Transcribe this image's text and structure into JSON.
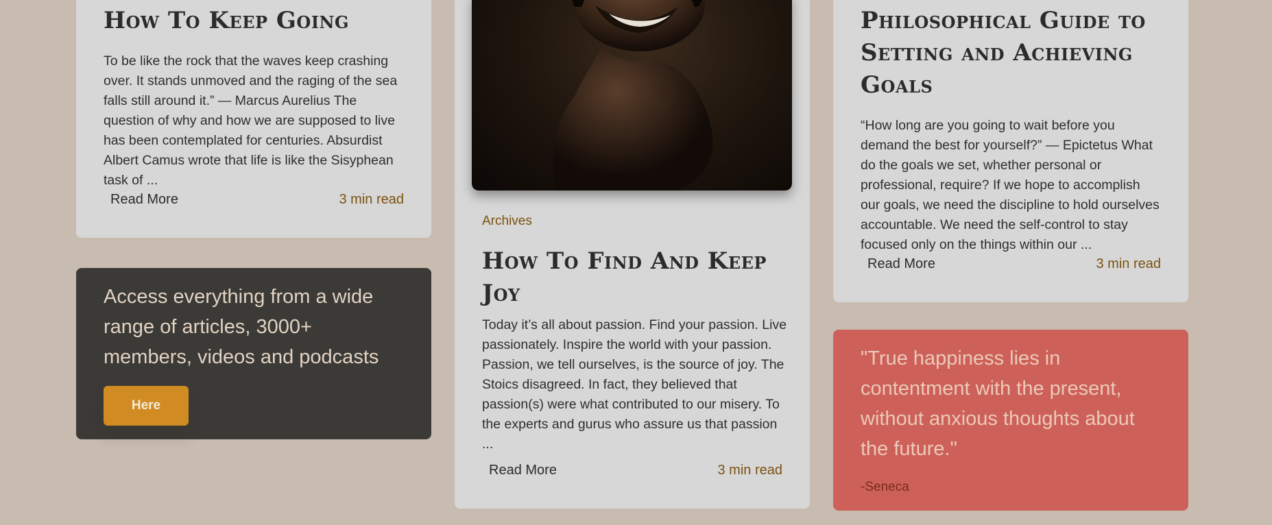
{
  "cards": {
    "keep_going": {
      "title": "How To Keep Going",
      "excerpt": "To be like the rock that the waves keep crashing over. It stands unmoved and the raging of the sea falls still around it.” — Marcus Aurelius The question of why and how we are supposed to live has been contemplated for centuries. Absurdist Albert Camus wrote that life is like the Sisyphean task of ...",
      "read_more": "Read More",
      "read_time": "3 min read"
    },
    "find_joy": {
      "category": "Archives",
      "title": "How To Find And Keep Joy",
      "excerpt": "Today it’s all about passion. Find your passion. Live passionately. Inspire the world with your passion. Passion, we tell ourselves, is the source of joy. The Stoics disagreed. In fact, they believed that passion(s) were what contributed to our misery. To the experts and gurus who assure us that passion ...",
      "read_more": "Read More",
      "read_time": "3 min read"
    },
    "goals": {
      "title": "Philosophical Guide to Setting and Achieving Goals",
      "excerpt": "“How long are you going to wait before you demand the best for yourself?” — Epictetus What do the goals we set, whether personal or professional, require? If we hope to accomplish our goals, we need the discipline to hold ourselves accountable. We need the self-control to stay focused only on the things within our ...",
      "read_more": "Read More",
      "read_time": "3 min read"
    }
  },
  "promo": {
    "text": "Access everything from a wide range of articles, 3000+ members, videos and podcasts",
    "button": "Here"
  },
  "quote": {
    "text": "\"True happiness lies in contentment with the present, without anxious thoughts about the future.\"",
    "author": "-Seneca"
  },
  "colors": {
    "background": "#c8bbb0",
    "card": "#d7d7d7",
    "promo_bg": "#3b3a36",
    "button": "#d08c22",
    "quote_bg": "#cd615a",
    "accent_text": "#7a5210"
  }
}
